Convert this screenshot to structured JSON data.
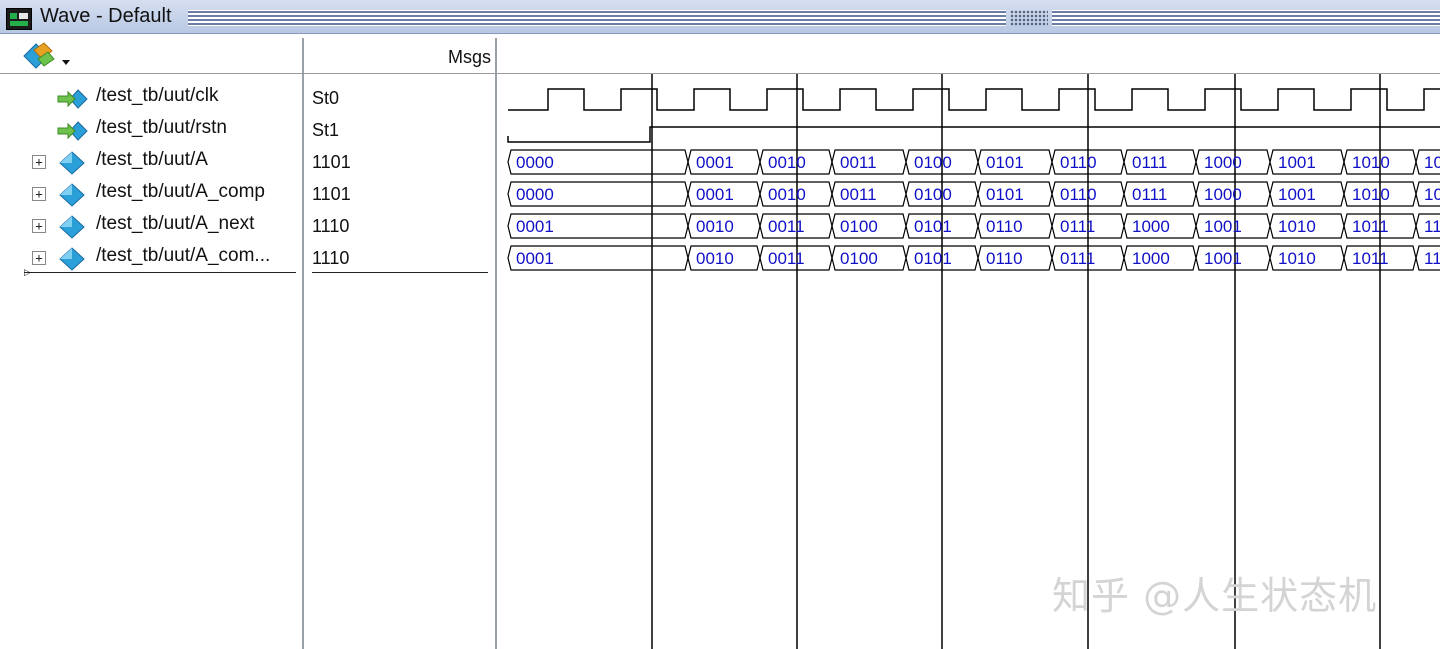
{
  "window": {
    "title": "Wave - Default"
  },
  "icons": {
    "app": "modelsim-wave-icon",
    "toolbar": "wave-add-dropdown-icon",
    "expand": "plus-box-icon",
    "clock_signal": "input-arrow-diamond-icon",
    "bus_signal": "diamond-icon"
  },
  "colors": {
    "wave_value_text": "#1010c8",
    "wave_line": "#000000",
    "diamond": "#2a9fd8",
    "arrow": "#6cc24a",
    "watermark": "#d4d4d4"
  },
  "columns": {
    "msgs": "Msgs"
  },
  "signals": [
    {
      "name": "/test_tb/uut/clk",
      "value": "St0",
      "expandable": false,
      "kind": "clock",
      "type": "clock",
      "period": 146,
      "high": 36,
      "low": 37
    },
    {
      "name": "/test_tb/uut/rstn",
      "value": "St1",
      "expandable": false,
      "kind": "reset",
      "type": "level",
      "low_until": 152
    },
    {
      "name": "/test_tb/uut/A",
      "value": "1101",
      "expandable": true,
      "kind": "bus",
      "type": "bus",
      "labels": [
        "0000",
        "0001",
        "0010",
        "0011",
        "0100",
        "0101",
        "0110",
        "0111",
        "1000",
        "1001",
        "1010",
        "10"
      ]
    },
    {
      "name": "/test_tb/uut/A_comp",
      "value": "1101",
      "expandable": true,
      "kind": "bus",
      "type": "bus",
      "labels": [
        "0000",
        "0001",
        "0010",
        "0011",
        "0100",
        "0101",
        "0110",
        "0111",
        "1000",
        "1001",
        "1010",
        "10"
      ]
    },
    {
      "name": "/test_tb/uut/A_next",
      "value": "1110",
      "expandable": true,
      "kind": "bus",
      "type": "bus",
      "labels": [
        "0001",
        "0010",
        "0011",
        "0100",
        "0101",
        "0110",
        "0111",
        "1000",
        "1001",
        "1010",
        "1011",
        "11"
      ]
    },
    {
      "name": "/test_tb/uut/A_com...",
      "value": "1110",
      "expandable": true,
      "kind": "bus",
      "type": "bus",
      "labels": [
        "0001",
        "0010",
        "0011",
        "0100",
        "0101",
        "0110",
        "0111",
        "1000",
        "1001",
        "1010",
        "1011",
        "11"
      ]
    }
  ],
  "watermark": {
    "text": "知乎 @人生状态机"
  }
}
